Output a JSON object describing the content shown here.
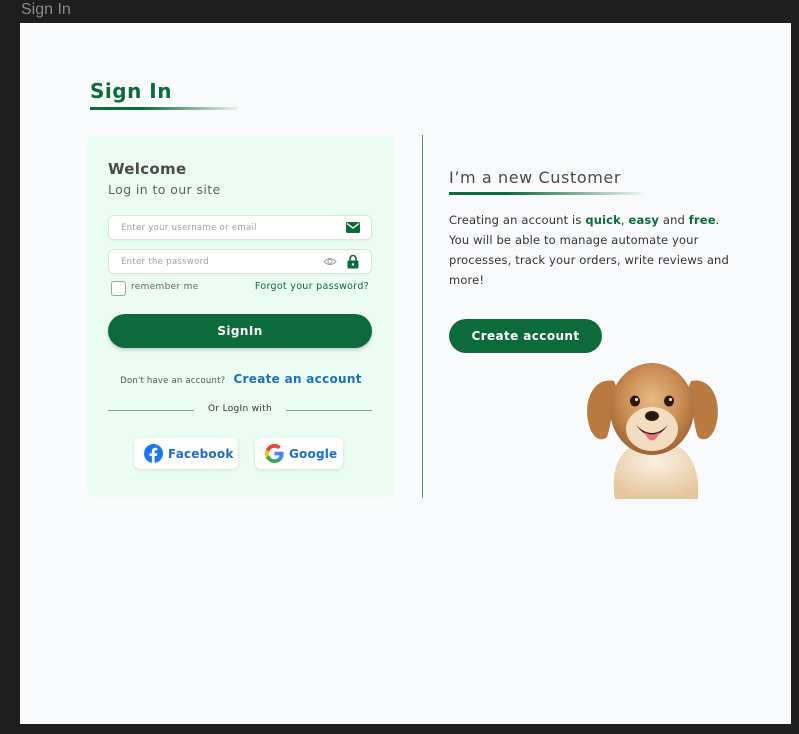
{
  "frame": {
    "label": "Sign In"
  },
  "page": {
    "title": "Sign In"
  },
  "login": {
    "welcome": "Welcome",
    "subtitle": "Log in to our site",
    "username_placeholder": "Enter your username or email",
    "username_value": "",
    "password_placeholder": "Enter the password",
    "password_value": "",
    "remember_label": "remember me",
    "remember_checked": false,
    "forgot_label": "Forgot your password?",
    "signin_label": "SignIn",
    "no_account_prompt": "Don't have an account?",
    "create_account_link": "Create an account",
    "divider_label": "Or LogIn with",
    "facebook_label": "Facebook",
    "google_label": "Google"
  },
  "customer": {
    "heading": "I’m a new Customer",
    "text_prefix": "Creating an account is ",
    "word_quick": "quick",
    "sep_comma": ", ",
    "word_easy": "easy",
    "sep_and": " and ",
    "word_free": "free",
    "text_suffix": ". You will be able to manage automate your processes, track your orders, write reviews and more!",
    "button_label": "Create account"
  },
  "icons": {
    "email": "envelope-icon",
    "password_visibility": "eye-icon",
    "password_lock": "lock-icon",
    "facebook": "facebook-logo-icon",
    "google": "google-logo-icon"
  },
  "colors": {
    "brand_green": "#0d6b3b",
    "link_blue": "#1d6fc6",
    "card_background": "#ebfdf2",
    "page_background": "#f9fafc"
  }
}
